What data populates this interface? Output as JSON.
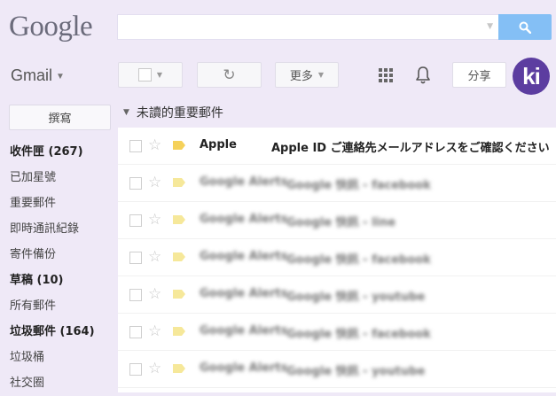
{
  "logo": "Google",
  "search": {
    "placeholder": ""
  },
  "app_label": "Gmail",
  "toolbar": {
    "more_label": "更多",
    "share_label": "分享"
  },
  "avatar_text": "ki",
  "compose_label": "撰寫",
  "sidebar": {
    "items": [
      {
        "label": "收件匣 (267)",
        "bold": true
      },
      {
        "label": "已加星號",
        "bold": false
      },
      {
        "label": "重要郵件",
        "bold": false
      },
      {
        "label": "即時通訊紀錄",
        "bold": false
      },
      {
        "label": "寄件備份",
        "bold": false
      },
      {
        "label": "草稿 (10)",
        "bold": true
      },
      {
        "label": "所有郵件",
        "bold": false
      },
      {
        "label": "垃圾郵件 (164)",
        "bold": true
      },
      {
        "label": "垃圾桶",
        "bold": false
      },
      {
        "label": "社交圈",
        "bold": false
      }
    ]
  },
  "section_title": "未讀的重要郵件",
  "emails": [
    {
      "sender": "Apple",
      "subject": "Apple ID ご連絡先メールアドレスをご確認ください",
      "snippet": ""
    },
    {
      "sender": "Google Alerts",
      "subject": "Google 快訊 - facebook",
      "snippet": ""
    },
    {
      "sender": "Google Alerts",
      "subject": "Google 快訊 - line",
      "snippet": ""
    },
    {
      "sender": "Google Alerts",
      "subject": "Google 快訊 - facebook",
      "snippet": ""
    },
    {
      "sender": "Google Alerts",
      "subject": "Google 快訊 - youtube",
      "snippet": ""
    },
    {
      "sender": "Google Alerts",
      "subject": "Google 快訊 - facebook",
      "snippet": ""
    },
    {
      "sender": "Google Alerts",
      "subject": "Google 快訊 - youtube",
      "snippet": ""
    }
  ]
}
